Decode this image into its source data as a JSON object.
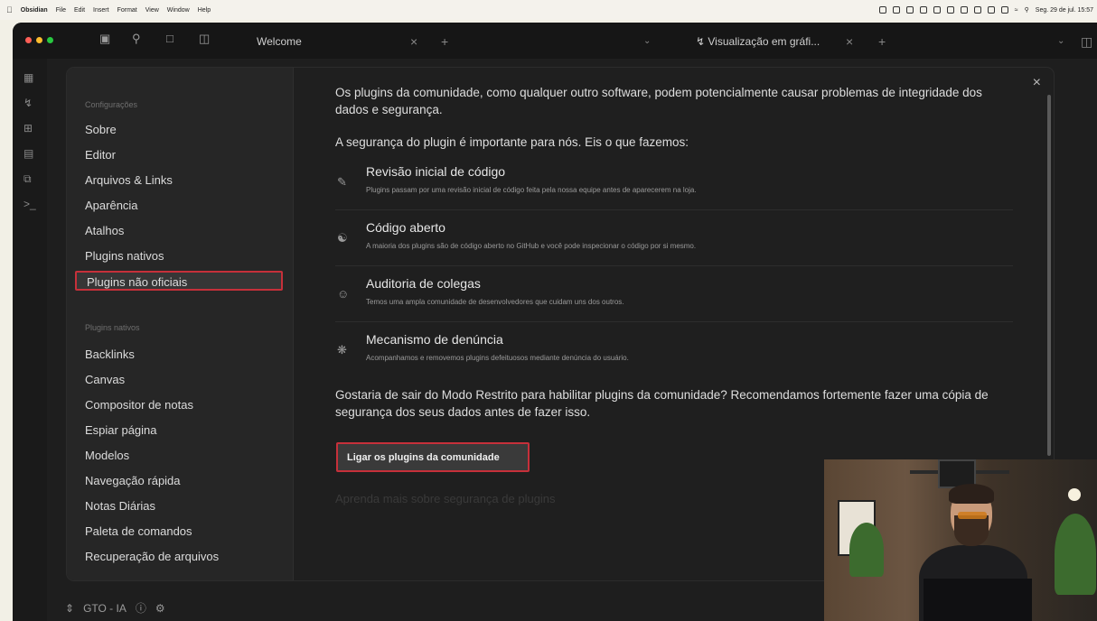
{
  "menubar": {
    "app": "Obsidian",
    "menus": [
      "File",
      "Edit",
      "Insert",
      "Format",
      "View",
      "Window",
      "Help"
    ],
    "datetime": "Seg. 29 de jul. 15:57"
  },
  "titlebar": {
    "tab1": "Welcome",
    "tab2": "Visualização em gráfi...",
    "icons": [
      "folder-icon",
      "search-icon",
      "bookmark-icon",
      "sidebar-toggle-icon"
    ]
  },
  "vault": {
    "name": "GTO - IA"
  },
  "sidebar": {
    "section1_heading": "Configurações",
    "section1_items": [
      "Sobre",
      "Editor",
      "Arquivos & Links",
      "Aparência",
      "Atalhos",
      "Plugins nativos",
      "Plugins não oficiais"
    ],
    "selected": "Plugins não oficiais",
    "section2_heading": "Plugins nativos",
    "section2_items": [
      "Backlinks",
      "Canvas",
      "Compositor de notas",
      "Espiar página",
      "Modelos",
      "Navegação rápida",
      "Notas Diárias",
      "Paleta de comandos",
      "Recuperação de arquivos"
    ]
  },
  "content": {
    "intro": "Os plugins da comunidade, como qualquer outro software, podem potencialmente causar problemas de integridade dos dados e segurança.",
    "subhead": "A segurança do plugin é importante para nós. Eis o que fazemos:",
    "features": [
      {
        "icon": "code-review-icon",
        "title": "Revisão inicial de código",
        "desc": "Plugins passam por uma revisão inicial de código feita pela nossa equipe antes de aparecerem na loja."
      },
      {
        "icon": "github-icon",
        "title": "Código aberto",
        "desc": "A maioria dos plugins são de código aberto no GitHub e você pode inspecionar o código por si mesmo."
      },
      {
        "icon": "users-icon",
        "title": "Auditoria de colegas",
        "desc": "Temos uma ampla comunidade de desenvolvedores que cuidam uns dos outros."
      },
      {
        "icon": "bug-icon",
        "title": "Mecanismo de denúncia",
        "desc": "Acompanhamos e removemos plugins defeituosos mediante denúncia do usuário."
      }
    ],
    "question": "Gostaria de sair do Modo Restrito para habilitar plugins da comunidade? Recomendamos fortemente fazer uma cópia de segurança dos seus dados antes de fazer isso.",
    "button": "Ligar os plugins da comunidade",
    "learn_more": "Aprenda mais sobre segurança de plugins"
  },
  "colors": {
    "highlight": "#c6303a",
    "modal_bg": "#1f1f1f",
    "sidebar_bg": "#262626"
  }
}
